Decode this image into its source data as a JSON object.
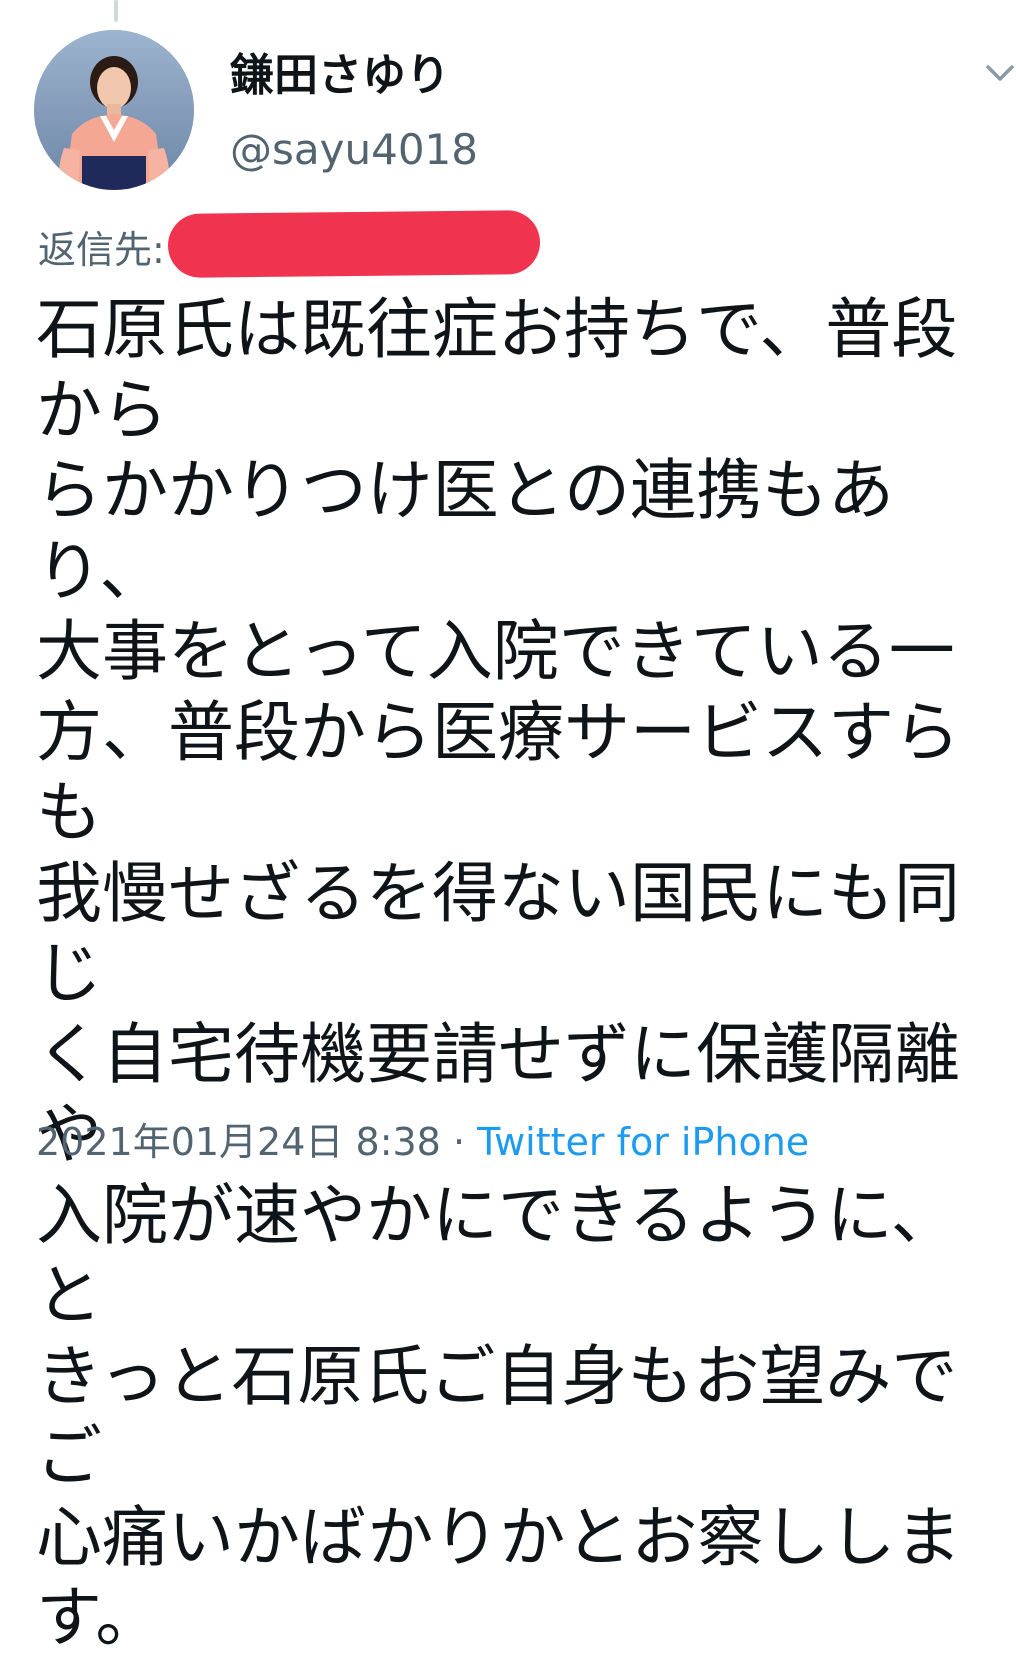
{
  "tweet": {
    "author": {
      "display_name": "鎌田さゆり",
      "handle": "@sayu4018",
      "avatar_icon": "profile-photo"
    },
    "menu_icon": "chevron-down-icon",
    "reply_prefix": "返信先:",
    "reply_target_redacted": true,
    "text": "石原氏は既往症お持ちで、普段から\nらかかりつけ医との連携もあり、\n大事をとって入院できている一\n方、普段から医療サービスすらも\n我慢せざるを得ない国民にも同じ\nく自宅待機要請せずに保護隔離や\n入院が速やかにできるように、と\nきっと石原氏ご自身もお望みでご\n心痛いかばかりかとお察ししま\nす。",
    "date": "2021年01月24日",
    "time": "8:38",
    "separator": "·",
    "source": "Twitter for iPhone"
  },
  "colors": {
    "text_primary": "#0f1419",
    "text_secondary": "#536471",
    "link": "#1d9bf0",
    "redaction": "#f0334f"
  }
}
